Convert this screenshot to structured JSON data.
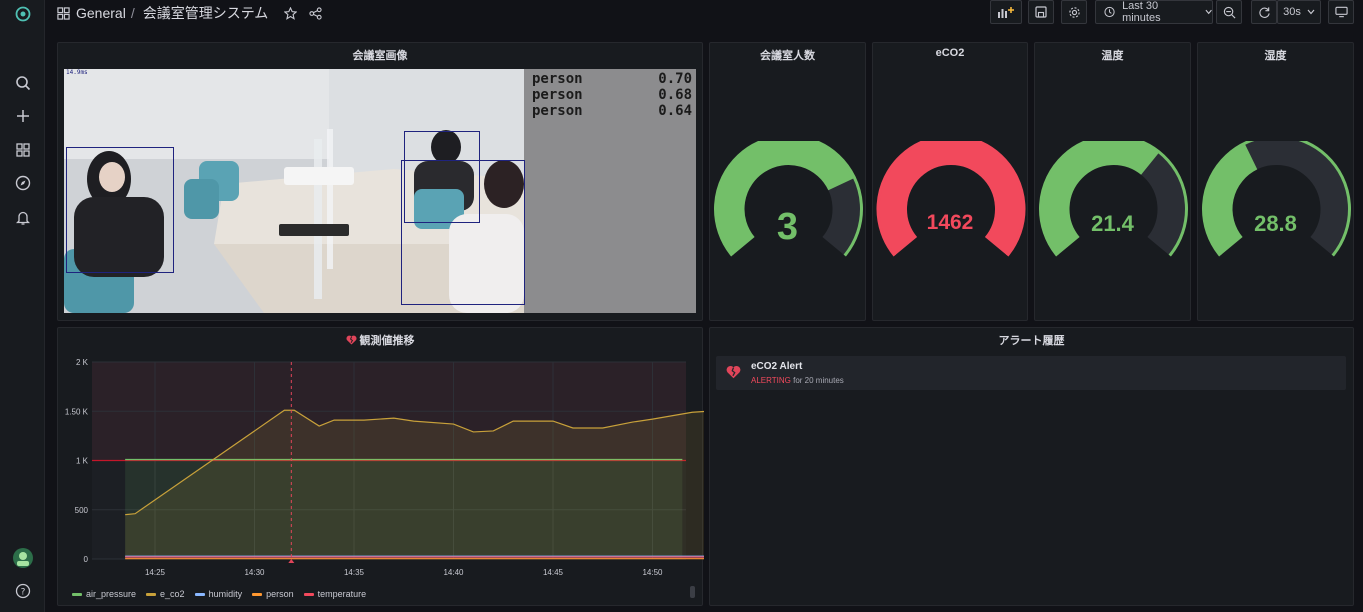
{
  "breadcrumb": {
    "folder": "General",
    "separator": "/",
    "title": "会議室管理システム"
  },
  "time_picker": {
    "label": "Last 30 minutes"
  },
  "refresh": {
    "interval": "30s"
  },
  "panels": {
    "camera": {
      "title": "会議室画像",
      "timestamp": "14.9ms",
      "detections": [
        {
          "label": "person",
          "score": "0.70"
        },
        {
          "label": "person",
          "score": "0.68"
        },
        {
          "label": "person",
          "score": "0.64"
        }
      ]
    },
    "people": {
      "title": "会議室人数",
      "value": "3",
      "fraction": 0.75,
      "color": "#73bf69"
    },
    "eco2": {
      "title": "eCO2",
      "value": "1462",
      "fraction": 1.0,
      "color": "#f2495c"
    },
    "temp": {
      "title": "温度",
      "value": "21.4",
      "fraction": 0.65,
      "color": "#73bf69"
    },
    "humidity": {
      "title": "湿度",
      "value": "28.8",
      "fraction": 0.4,
      "color": "#73bf69"
    },
    "trend": {
      "title": "観測値推移"
    },
    "alerts": {
      "title": "アラート履歴",
      "items": [
        {
          "name": "eCO2 Alert",
          "state": "ALERTING",
          "duration": "for 20 minutes"
        }
      ]
    }
  },
  "chart_data": {
    "type": "line",
    "x": [
      "14:25",
      "14:30",
      "14:35",
      "14:40",
      "14:45",
      "14:50"
    ],
    "ylim": [
      0,
      2000
    ],
    "yticks": [
      "0",
      "500",
      "1 K",
      "1.50 K",
      "2 K"
    ],
    "threshold": 1000,
    "alert_marker_x": 1.37,
    "series": [
      {
        "name": "air_pressure",
        "color": "#73bf69",
        "points": [
          [
            -0.3,
            1010
          ],
          [
            5.3,
            1010
          ]
        ]
      },
      {
        "name": "e_co2",
        "color": "#c8a13a",
        "points": [
          [
            -0.3,
            450
          ],
          [
            -0.2,
            460
          ],
          [
            1.3,
            1510
          ],
          [
            1.4,
            1510
          ],
          [
            1.65,
            1350
          ],
          [
            1.8,
            1410
          ],
          [
            2.1,
            1410
          ],
          [
            2.4,
            1430
          ],
          [
            2.6,
            1400
          ],
          [
            3.0,
            1370
          ],
          [
            3.2,
            1290
          ],
          [
            3.4,
            1300
          ],
          [
            3.6,
            1400
          ],
          [
            4.0,
            1400
          ],
          [
            4.2,
            1330
          ],
          [
            4.5,
            1330
          ],
          [
            4.8,
            1390
          ],
          [
            5.0,
            1420
          ],
          [
            5.4,
            1490
          ],
          [
            5.55,
            1500
          ],
          [
            5.65,
            1460
          ],
          [
            5.75,
            1470
          ],
          [
            5.8,
            1440
          ],
          [
            5.9,
            1460
          ],
          [
            6.0,
            1430
          ],
          [
            6.1,
            1450
          ],
          [
            6.2,
            1430
          ],
          [
            6.3,
            1440
          ]
        ]
      },
      {
        "name": "humidity",
        "color": "#8ab8ff",
        "points": [
          [
            -0.3,
            28
          ],
          [
            6.3,
            28
          ]
        ]
      },
      {
        "name": "person",
        "color": "#ff9830",
        "points": [
          [
            -0.3,
            3
          ],
          [
            6.3,
            3
          ]
        ]
      },
      {
        "name": "temperature",
        "color": "#f2495c",
        "points": [
          [
            -0.3,
            21
          ],
          [
            6.3,
            21
          ]
        ]
      }
    ]
  }
}
